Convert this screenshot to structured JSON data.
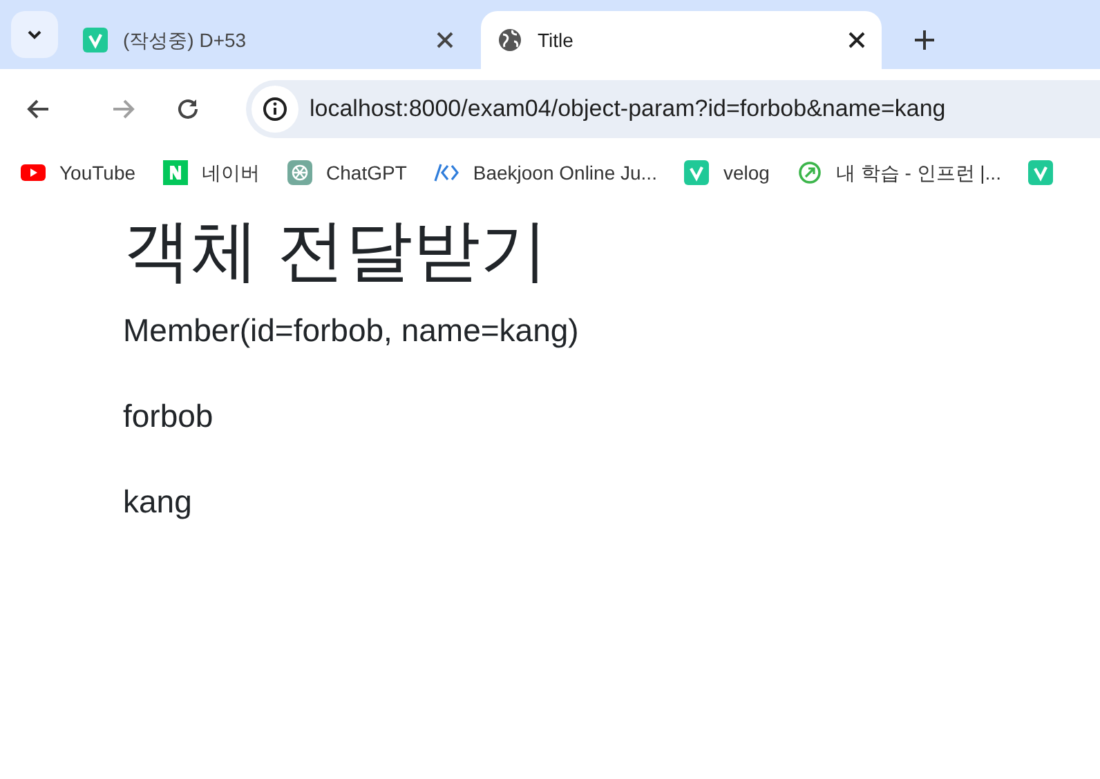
{
  "tabs": [
    {
      "label": "(작성중) D+53",
      "selected": false,
      "kind": "velog"
    },
    {
      "label": "Title",
      "selected": true,
      "kind": "globe"
    }
  ],
  "toolbar": {
    "forward_disabled": true,
    "address": "localhost:8000/exam04/object-param?id=forbob&name=kang"
  },
  "bookmarks": [
    {
      "label": "YouTube",
      "kind": "youtube"
    },
    {
      "label": "네이버",
      "kind": "naver"
    },
    {
      "label": "ChatGPT",
      "kind": "chatgpt"
    },
    {
      "label": "Baekjoon Online Ju...",
      "kind": "code"
    },
    {
      "label": "velog",
      "kind": "velog"
    },
    {
      "label": "내 학습 - 인프런 |...",
      "kind": "leaf"
    },
    {
      "kind": "velog"
    }
  ],
  "page": {
    "heading": "객체 전달받기",
    "paragraphs": [
      "Member(id=forbob, name=kang)",
      "forbob",
      "kang"
    ]
  }
}
